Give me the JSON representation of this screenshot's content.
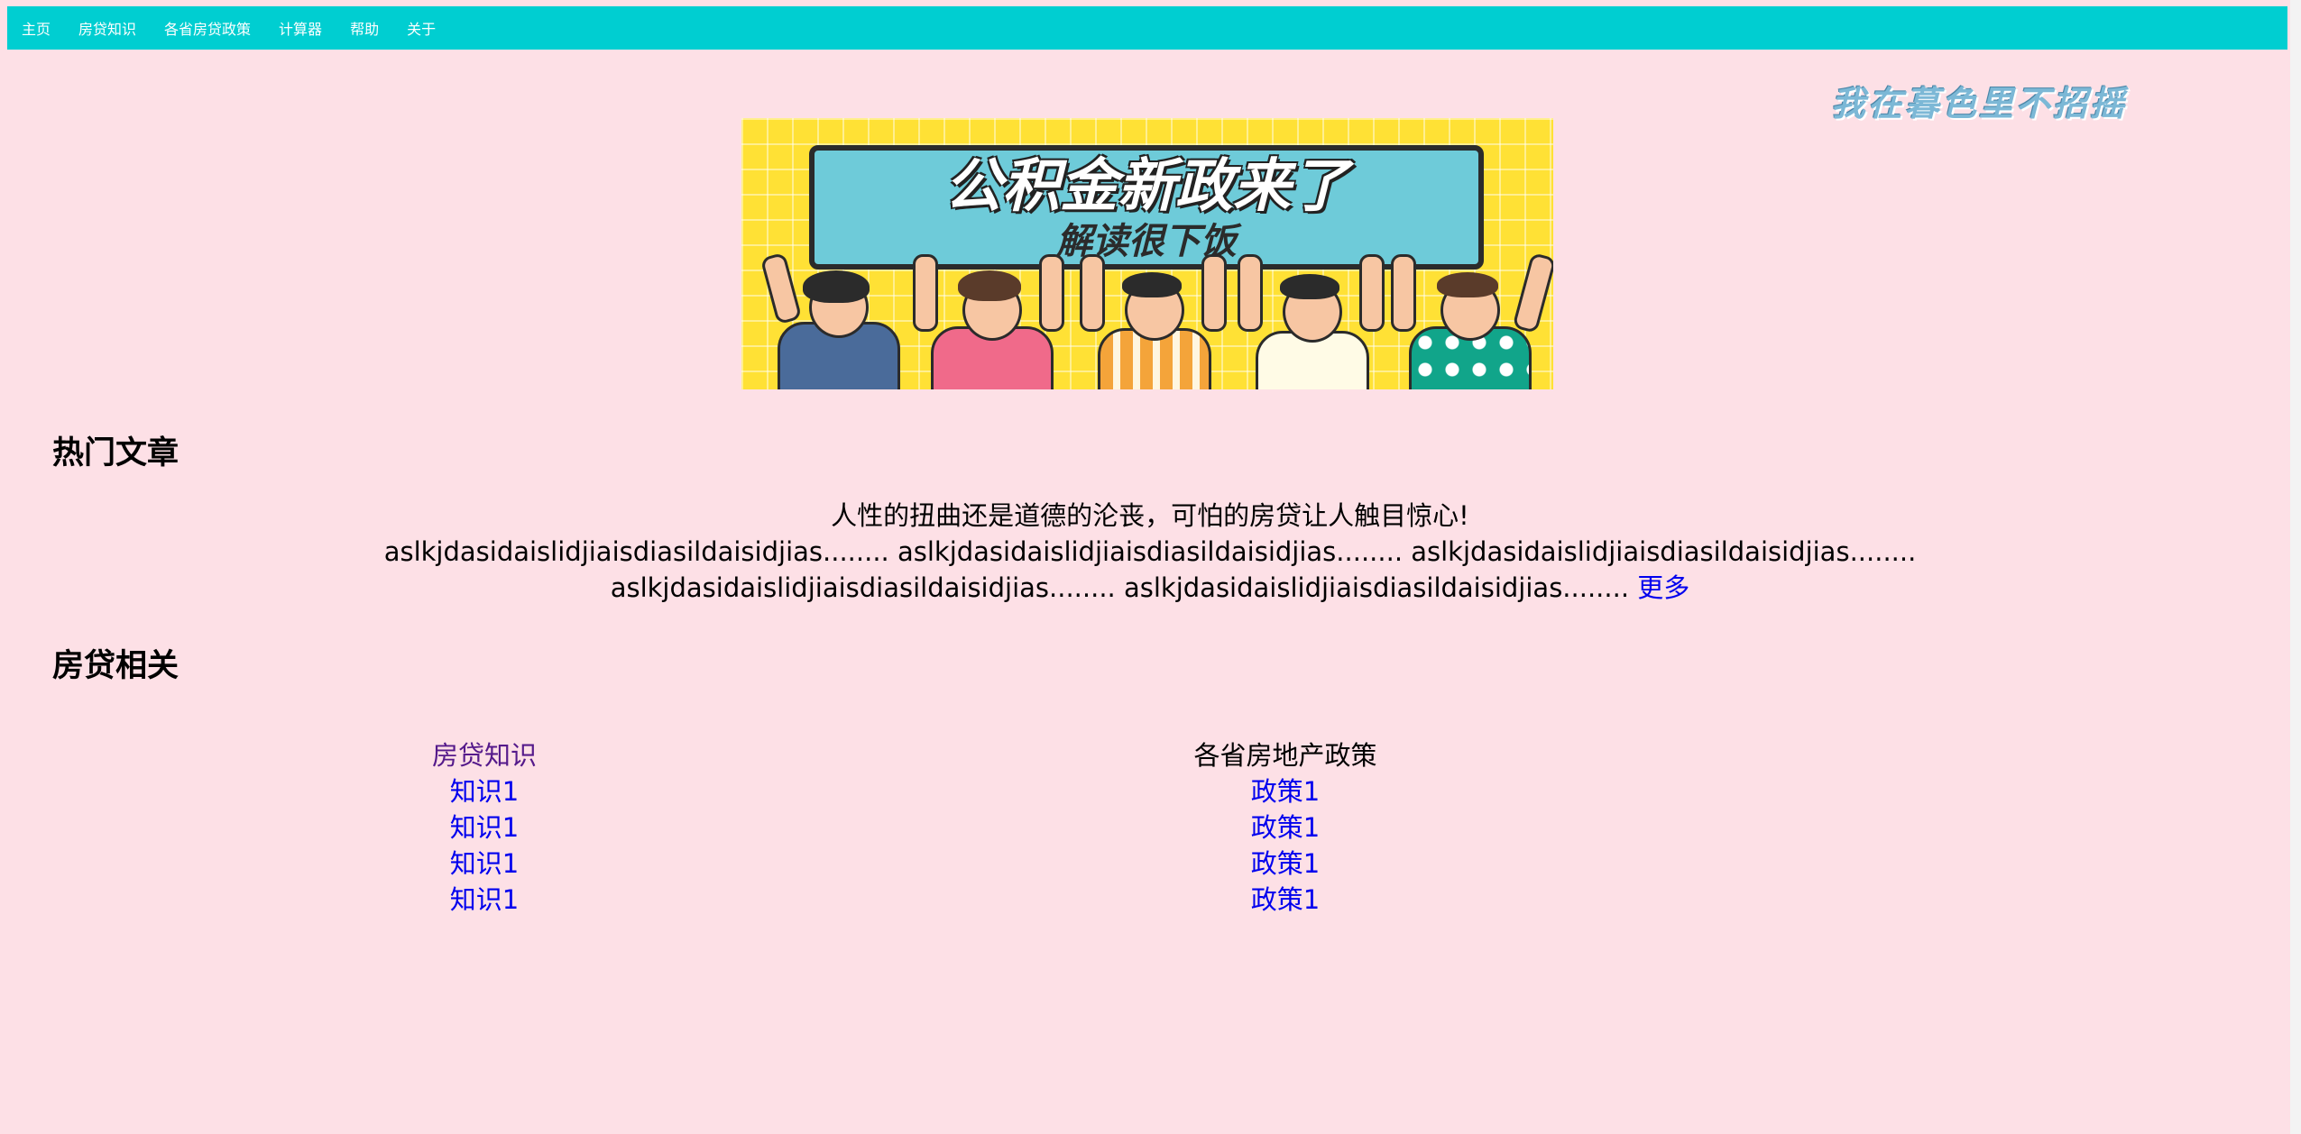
{
  "nav": {
    "items": [
      "主页",
      "房贷知识",
      "各省房贷政策",
      "计算器",
      "帮助",
      "关于"
    ]
  },
  "slogan": "我在暮色里不招摇",
  "banner": {
    "title": "公积金新政来了",
    "subtitle": "解读很下饭"
  },
  "hot": {
    "heading": "热门文章",
    "article_title": "人性的扭曲还是道德的沦丧，可怕的房贷让人触目惊心!",
    "article_body": "aslkjdasidaislidjiaisdiasildaisidjias........ aslkjdasidaislidjiaisdiasildaisidjias........ aslkjdasidaislidjiaisdiasildaisidjias........ aslkjdasidaislidjiaisdiasildaisidjias........ aslkjdasidaislidjiaisdiasildaisidjias........",
    "more": "更多"
  },
  "related": {
    "heading": "房贷相关",
    "knowledge": {
      "title": "房贷知识",
      "items": [
        "知识1",
        "知识1",
        "知识1",
        "知识1"
      ]
    },
    "policy": {
      "title": "各省房地产政策",
      "items": [
        "政策1",
        "政策1",
        "政策1",
        "政策1"
      ]
    }
  },
  "colors": {
    "background": "#fde0e6",
    "nav": "#00ced1",
    "link": "#0000ee",
    "visited_link": "#551a8b"
  }
}
